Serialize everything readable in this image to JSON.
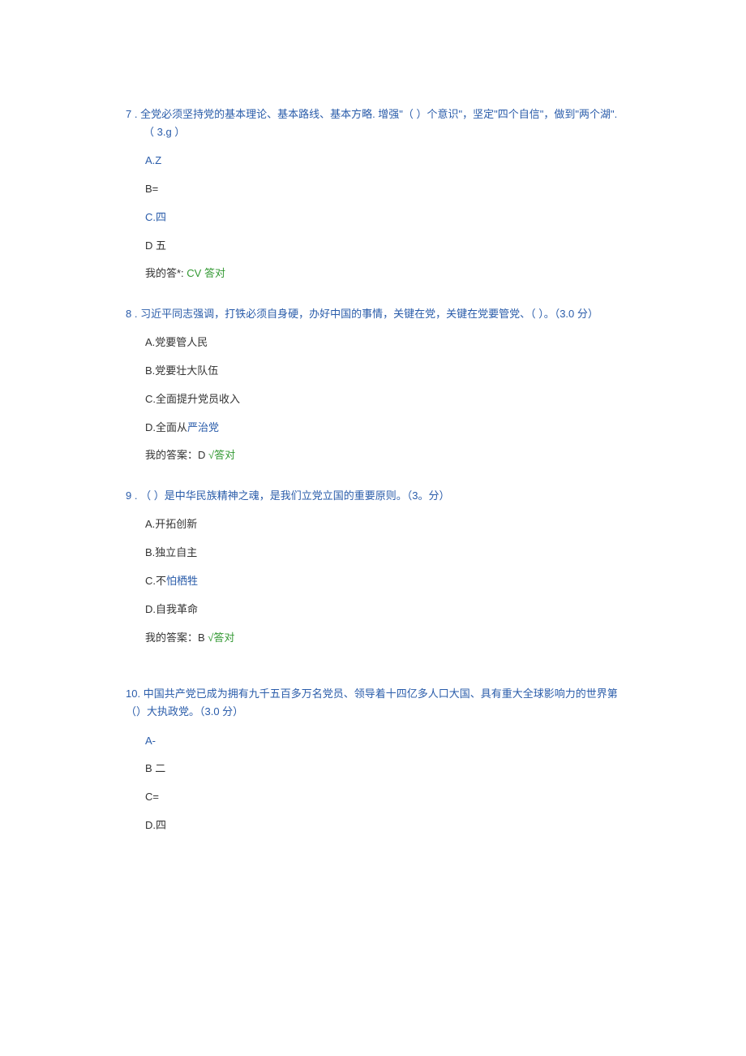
{
  "q7": {
    "num": "7",
    "sep": " . ",
    "text_part1": "全党必须坚持党的基本理论、基本路线、基本方略. 增强\"",
    "blank": "（ ）",
    "text_part2": "个意识\"，坚定\"四个自信\"，做到\"两个湖\".",
    "points_line": "（ 3.g ）",
    "options": {
      "a": "A.Z",
      "b": "B=",
      "c": "C.四",
      "d": "D 五"
    },
    "answer_label": "我的答*: ",
    "answer_value": "CV 答对"
  },
  "q8": {
    "num": "8",
    "sep": "  .",
    "text": "习近平同志强调，打铁必须自身硬，办好中国的事情，关键在党，关键在党要管党、（ ）。（3.0 分）",
    "options": {
      "a": "A.党要管人民",
      "b": "B.党要壮大队伍",
      "c": "C.全面提升党员收入",
      "d_prefix": "D.全面从",
      "d_blue": "严治党"
    },
    "answer_label": "我的答案：D ",
    "answer_value": "√答对"
  },
  "q9": {
    "num": "9",
    "sep": "  .",
    "text_part1": "（ ）是中华民族精神之魂，是我们立",
    "text_blue": "党立国",
    "text_part2": "的重要原则。（3。分）",
    "options": {
      "a": "A.开拓创新",
      "b": "B.独立自主",
      "c_prefix": "C.不",
      "c_blue": "怕栖牲",
      "d": "D.自我革命"
    },
    "answer_label": "我的答案：B ",
    "answer_value": "√答对"
  },
  "q10": {
    "num": "10. ",
    "text": "中国共产党已成为拥有九千五百多万名党员、领导着十四亿多人口大国、具有重大全球影响力的世界第（）大执政党。（3.0 分）",
    "options": {
      "a": "A-",
      "b": "B 二",
      "c": "C=",
      "d": "D.四"
    }
  }
}
